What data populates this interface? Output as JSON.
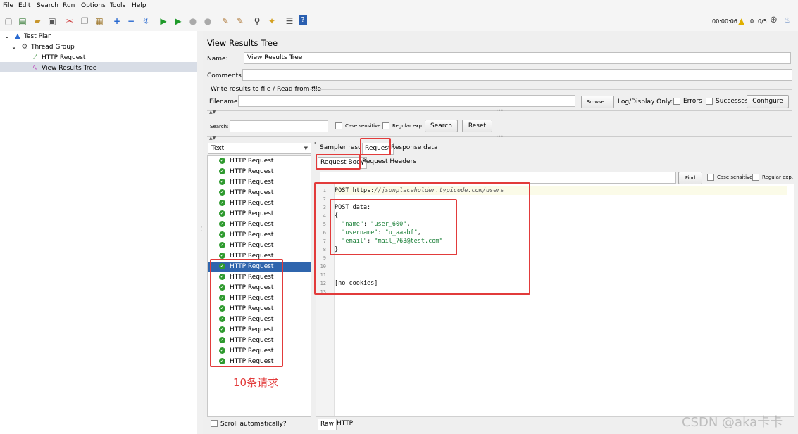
{
  "menu": [
    "File",
    "Edit",
    "Search",
    "Run",
    "Options",
    "Tools",
    "Help"
  ],
  "toolbar": {
    "timer": "00:00:06",
    "warnings": "0",
    "threads": "0/5"
  },
  "tree": {
    "test_plan": "Test Plan",
    "thread_group": "Thread Group",
    "http_request": "HTTP Request",
    "view_results_tree": "View Results Tree"
  },
  "panel": {
    "title": "View Results Tree",
    "name_label": "Name:",
    "name_value": "View Results Tree",
    "comments_label": "Comments:",
    "write_results_label": "Write results to file / Read from file",
    "filename_label": "Filename",
    "browse_label": "Browse...",
    "logdisplay_label": "Log/Display Only:",
    "errors_label": "Errors",
    "successes_label": "Successes",
    "configure_label": "Configure",
    "search_label": "Search:",
    "case_sensitive": "Case sensitive",
    "regular_exp": "Regular exp.",
    "search_button": "Search",
    "reset_button": "Reset"
  },
  "results": {
    "renderer": "Text",
    "items": [
      "HTTP Request",
      "HTTP Request",
      "HTTP Request",
      "HTTP Request",
      "HTTP Request",
      "HTTP Request",
      "HTTP Request",
      "HTTP Request",
      "HTTP Request",
      "HTTP Request",
      "HTTP Request",
      "HTTP Request",
      "HTTP Request",
      "HTTP Request",
      "HTTP Request",
      "HTTP Request",
      "HTTP Request",
      "HTTP Request",
      "HTTP Request",
      "HTTP Request"
    ],
    "selected_index": 10,
    "scroll_auto_label": "Scroll automatically?",
    "annotation": "10条请求"
  },
  "tabs": {
    "sampler_result": "Sampler result",
    "request": "Request",
    "response_data": "Response data",
    "request_body": "Request Body",
    "request_headers": "Request Headers",
    "find_button": "Find",
    "case_sensitive": "Case sensitive",
    "regular_exp": "Regular exp.",
    "raw": "Raw",
    "http": "HTTP"
  },
  "editor": {
    "line_numbers": [
      "1",
      "2",
      "3",
      "4",
      "5",
      "6",
      "7",
      "8",
      "9",
      "10",
      "11",
      "12",
      "13"
    ],
    "line1_method": "POST ",
    "line1_url_prefix": "https:",
    "line1_url_rest": "//jsonplaceholder.typicode.com/users",
    "line3": "POST data:",
    "line4": "{",
    "line5_key": "\"name\"",
    "line5_val": "\"user_600\"",
    "line6_key": "\"username\"",
    "line6_val": "\"u_aaabf\"",
    "line7_key": "\"email\"",
    "line7_val": "\"mail_763@test.com\"",
    "line8": "}",
    "line12": "[no cookies]"
  },
  "watermark": "CSDN @aka卡卡",
  "colors": {
    "selection": "#2f65ad",
    "annotation_red": "#e23b3b",
    "success_green": "#2e9a2e"
  }
}
